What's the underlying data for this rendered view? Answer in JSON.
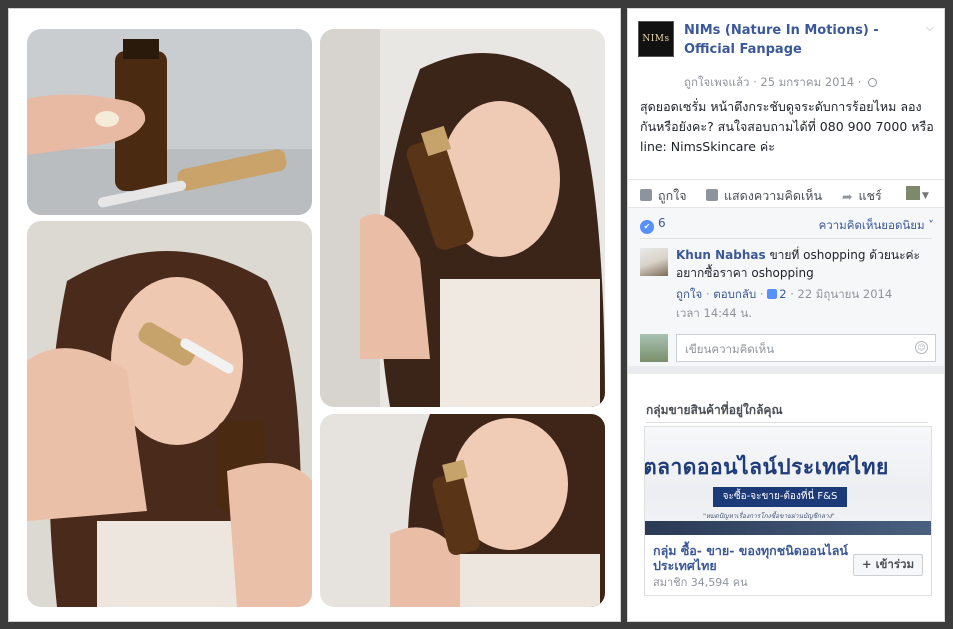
{
  "post": {
    "page_logo_text": "NIMs",
    "page_name": "NIMs (Nature In Motions) - Official Fanpage",
    "liked_text": "ถูกใจเพจแล้ว",
    "date": "25 มกราคม 2014",
    "text": "สุดยอดเซรั่ม หน้าตึงกระชับดูจระดับการร้อยไหม ลองกันหรือยังคะ? สนใจสอบถามได้ที่ 080 900 7000 หรือ line: NimsSkincare ค่ะ",
    "actions": {
      "like": "ถูกใจ",
      "comment": "แสดงความคิดเห็น",
      "share": "แชร์"
    }
  },
  "engagement": {
    "like_count": "6",
    "top_comments_label": "ความคิดเห็นยอดนิยม"
  },
  "comment": {
    "author": "Khun Nabhas",
    "text": "ขายที่ oshopping ด้วยนะค่ะ อยากซื้อราคา oshopping",
    "like_action": "ถูกใจ",
    "reply_action": "ตอบกลับ",
    "like_count": "2",
    "date": "22 มิถุนายน 2014",
    "time": "เวลา 14:44 น."
  },
  "write_comment": {
    "placeholder": "เขียนความคิดเห็น"
  },
  "groups": {
    "title": "กลุ่มขายสินค้าที่อยู่ใกล้คุณ",
    "banner_title": "ตลาดออนไลน์ประเทศไทย",
    "banner_bar": "จะซื้อ-จะขาย-ต้องที่นี่ F&S",
    "banner_sub": "\"หมดปัญหาเรื่องการโกงซื้อขายผ่านบัญชีกลาง\"",
    "name": "กลุ่ม ซื้อ- ขาย- ของทุกชนิดออนไลน์ ประเทศไทย",
    "members": "สมาชิก 34,594 คน",
    "join_label": "+ เข้าร่วม"
  },
  "colors": {
    "link": "#3b5998",
    "like_badge": "#5890ff",
    "banner_navy": "#1d3a78"
  }
}
